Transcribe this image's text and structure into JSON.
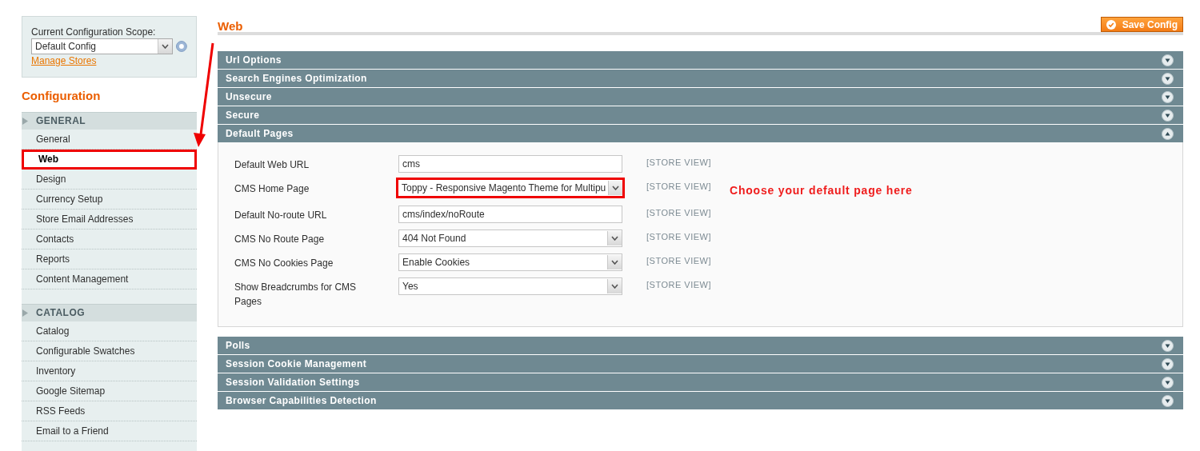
{
  "scope": {
    "label": "Current Configuration Scope:",
    "value": "Default Config",
    "link": "Manage Stores"
  },
  "sidebar": {
    "title": "Configuration",
    "groups": [
      {
        "label": "GENERAL",
        "items": [
          {
            "label": "General",
            "selected": false,
            "highlighted": false
          },
          {
            "label": "Web",
            "selected": true,
            "highlighted": true
          },
          {
            "label": "Design",
            "selected": false,
            "highlighted": false
          },
          {
            "label": "Currency Setup",
            "selected": false,
            "highlighted": false
          },
          {
            "label": "Store Email Addresses",
            "selected": false,
            "highlighted": false
          },
          {
            "label": "Contacts",
            "selected": false,
            "highlighted": false
          },
          {
            "label": "Reports",
            "selected": false,
            "highlighted": false
          },
          {
            "label": "Content Management",
            "selected": false,
            "highlighted": false
          }
        ]
      },
      {
        "label": "CATALOG",
        "items": [
          {
            "label": "Catalog",
            "selected": false,
            "highlighted": false
          },
          {
            "label": "Configurable Swatches",
            "selected": false,
            "highlighted": false
          },
          {
            "label": "Inventory",
            "selected": false,
            "highlighted": false
          },
          {
            "label": "Google Sitemap",
            "selected": false,
            "highlighted": false
          },
          {
            "label": "RSS Feeds",
            "selected": false,
            "highlighted": false
          },
          {
            "label": "Email to a Friend",
            "selected": false,
            "highlighted": false
          }
        ]
      }
    ]
  },
  "page": {
    "title": "Web",
    "save_button": "Save Config"
  },
  "sections": [
    {
      "title": "Url Options",
      "expanded": false
    },
    {
      "title": "Search Engines Optimization",
      "expanded": false
    },
    {
      "title": "Unsecure",
      "expanded": false
    },
    {
      "title": "Secure",
      "expanded": false
    },
    {
      "title": "Default Pages",
      "expanded": true,
      "fields": [
        {
          "kind": "text",
          "label": "Default Web URL",
          "value": "cms",
          "scope": "[STORE VIEW]",
          "highlighted": false
        },
        {
          "kind": "select",
          "label": "CMS Home Page",
          "value": "Toppy - Responsive Magento Theme for Multipu",
          "scope": "[STORE VIEW]",
          "highlighted": true,
          "note": "Choose your default page here"
        },
        {
          "kind": "text",
          "label": "Default No-route URL",
          "value": "cms/index/noRoute",
          "scope": "[STORE VIEW]",
          "highlighted": false
        },
        {
          "kind": "select",
          "label": "CMS No Route Page",
          "value": "404 Not Found",
          "scope": "[STORE VIEW]",
          "highlighted": false
        },
        {
          "kind": "select",
          "label": "CMS No Cookies Page",
          "value": "Enable Cookies",
          "scope": "[STORE VIEW]",
          "highlighted": false
        },
        {
          "kind": "select",
          "label": "Show  Breadcrumbs for CMS Pages",
          "value": "Yes",
          "scope": "[STORE VIEW]",
          "highlighted": false
        }
      ]
    },
    {
      "title": "Polls",
      "expanded": false
    },
    {
      "title": "Session Cookie Management",
      "expanded": false
    },
    {
      "title": "Session Validation Settings",
      "expanded": false
    },
    {
      "title": "Browser Capabilities Detection",
      "expanded": false
    }
  ]
}
